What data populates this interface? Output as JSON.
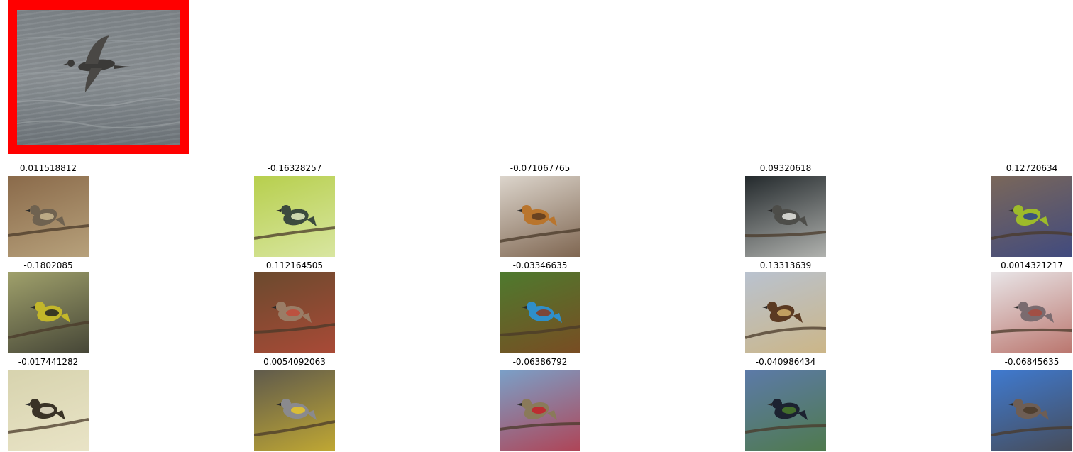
{
  "query": {
    "frame_color": "#ff0000",
    "subject": "albatross-over-sea"
  },
  "results": [
    {
      "score": "0.011518812",
      "subject": "flycatcher-on-branch",
      "bg": "#8a6a4a",
      "fg": "#6f6250",
      "accent": "#c9b78f"
    },
    {
      "score": "-0.16328257",
      "subject": "warbler-on-branch",
      "bg": "#b7cf4d",
      "fg": "#3c4a3e",
      "accent": "#e6efc2"
    },
    {
      "score": "-0.071067765",
      "subject": "finch-on-snow",
      "bg": "#dcd5cc",
      "fg": "#b9752d",
      "accent": "#5a3a20"
    },
    {
      "score": "0.09320618",
      "subject": "loon-on-water",
      "bg": "#23292c",
      "fg": "#4d4d49",
      "accent": "#e8e8e2"
    },
    {
      "score": "0.12720634",
      "subject": "green-jay",
      "bg": "#7a675a",
      "fg": "#9dbb2a",
      "accent": "#2a3f8d"
    },
    {
      "score": "-0.1802085",
      "subject": "hooded-warbler",
      "bg": "#9fa06b",
      "fg": "#c3b72a",
      "accent": "#222222"
    },
    {
      "score": "0.112164505",
      "subject": "flicker-on-feeder",
      "bg": "#6b4a2e",
      "fg": "#9a7d66",
      "accent": "#c24a3a"
    },
    {
      "score": "-0.03346635",
      "subject": "kingfisher-on-branch",
      "bg": "#4e7a2e",
      "fg": "#2f8fc9",
      "accent": "#8a3a1e"
    },
    {
      "score": "0.13313639",
      "subject": "blackbird-on-twig",
      "bg": "#b9c2cf",
      "fg": "#5b3a22",
      "accent": "#d3b16b"
    },
    {
      "score": "0.0014321217",
      "subject": "junco-on-snow",
      "bg": "#e8e4e6",
      "fg": "#7a6b6f",
      "accent": "#a84a3e"
    },
    {
      "score": "-0.017441282",
      "subject": "duck-on-water",
      "bg": "#d7d3ae",
      "fg": "#3a3326",
      "accent": "#f0ead0"
    },
    {
      "score": "0.0054092063",
      "subject": "yellow-rumped-warbler",
      "bg": "#5f5a4c",
      "fg": "#8a8a8e",
      "accent": "#e6c629"
    },
    {
      "score": "-0.06386792",
      "subject": "woodpecker-on-post",
      "bg": "#7aa0c8",
      "fg": "#8a7a5a",
      "accent": "#c4202a"
    },
    {
      "score": "-0.040986434",
      "subject": "cormorant-on-rock",
      "bg": "#5c7aa8",
      "fg": "#1c2230",
      "accent": "#4a7a2a"
    },
    {
      "score": "-0.06845635",
      "subject": "bird-on-branch-sky",
      "bg": "#3f7ad0",
      "fg": "#6e5e55",
      "accent": "#4a3a2a"
    }
  ]
}
